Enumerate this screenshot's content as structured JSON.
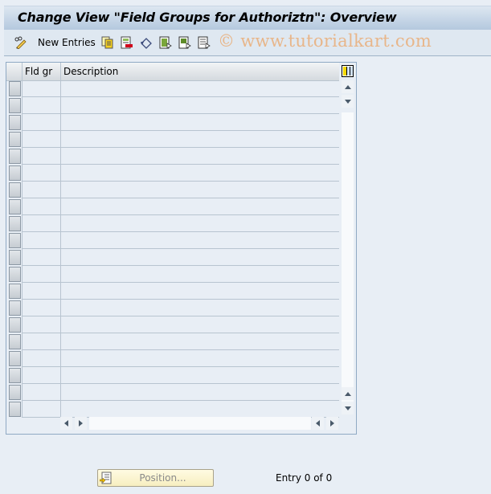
{
  "window": {
    "title": "Change View \"Field Groups for Authoriztn\": Overview"
  },
  "toolbar": {
    "items": [
      {
        "name": "display-change-icon",
        "label": ""
      },
      {
        "name": "new-entries",
        "label": "New Entries"
      },
      {
        "name": "copy-as-icon",
        "label": ""
      },
      {
        "name": "delete-icon",
        "label": ""
      },
      {
        "name": "undo-change-icon",
        "label": ""
      },
      {
        "name": "select-all-icon",
        "label": ""
      },
      {
        "name": "select-block-icon",
        "label": ""
      },
      {
        "name": "deselect-all-icon",
        "label": ""
      }
    ],
    "new_entries_label": "New Entries",
    "watermark": "© www.tutorialkart.com"
  },
  "table": {
    "columns": [
      {
        "key": "fld_gr",
        "label": "Fld gr"
      },
      {
        "key": "description",
        "label": "Description"
      }
    ],
    "rows": [
      {
        "fld_gr": "",
        "description": ""
      },
      {
        "fld_gr": "",
        "description": ""
      },
      {
        "fld_gr": "",
        "description": ""
      },
      {
        "fld_gr": "",
        "description": ""
      },
      {
        "fld_gr": "",
        "description": ""
      },
      {
        "fld_gr": "",
        "description": ""
      },
      {
        "fld_gr": "",
        "description": ""
      },
      {
        "fld_gr": "",
        "description": ""
      },
      {
        "fld_gr": "",
        "description": ""
      },
      {
        "fld_gr": "",
        "description": ""
      },
      {
        "fld_gr": "",
        "description": ""
      },
      {
        "fld_gr": "",
        "description": ""
      },
      {
        "fld_gr": "",
        "description": ""
      },
      {
        "fld_gr": "",
        "description": ""
      },
      {
        "fld_gr": "",
        "description": ""
      },
      {
        "fld_gr": "",
        "description": ""
      },
      {
        "fld_gr": "",
        "description": ""
      },
      {
        "fld_gr": "",
        "description": ""
      },
      {
        "fld_gr": "",
        "description": ""
      },
      {
        "fld_gr": "",
        "description": ""
      }
    ]
  },
  "footer": {
    "position_button_label": "Position...",
    "entry_status": "Entry 0 of 0"
  }
}
